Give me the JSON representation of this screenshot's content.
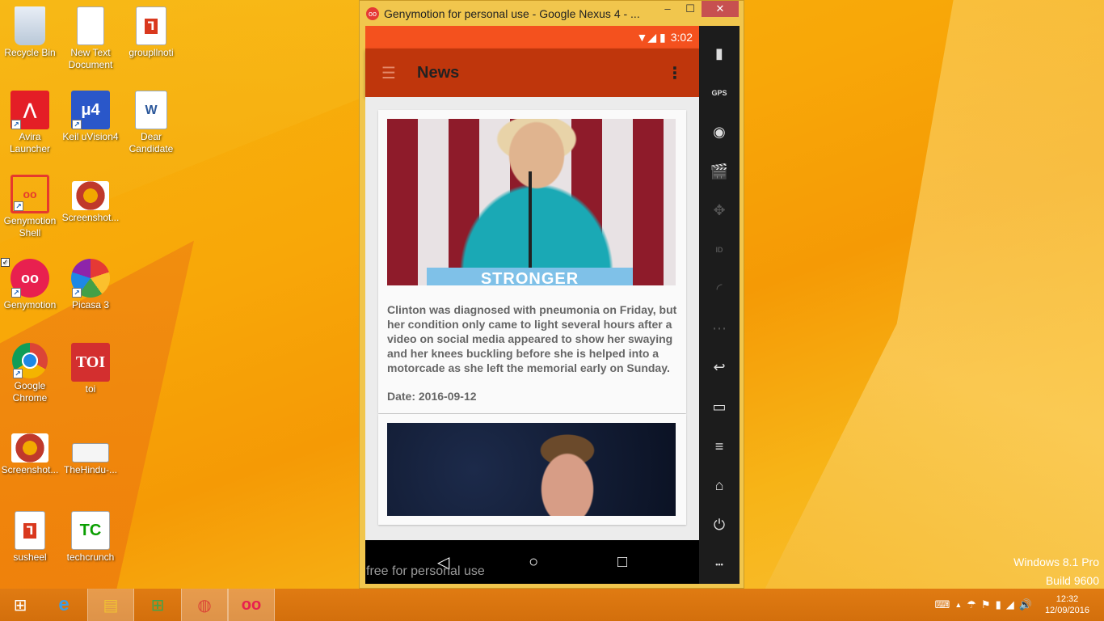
{
  "desktop": {
    "icons": [
      {
        "label": "Recycle Bin",
        "icon": "recycle-bin-icon"
      },
      {
        "label": "New Text Document",
        "icon": "text-document-icon"
      },
      {
        "label": "groupllnoti",
        "icon": "pdf-icon"
      },
      {
        "label": "Avira Launcher",
        "icon": "avira-icon"
      },
      {
        "label": "Keil uVision4",
        "icon": "keil-icon"
      },
      {
        "label": "Dear Candidate",
        "icon": "word-document-icon"
      },
      {
        "label": "Genymotion Shell",
        "icon": "genymotion-shell-icon"
      },
      {
        "label": "Screenshot...",
        "icon": "image-icon"
      },
      {
        "label": "Genymotion",
        "icon": "genymotion-icon"
      },
      {
        "label": "Picasa 3",
        "icon": "picasa-icon"
      },
      {
        "label": "Google Chrome",
        "icon": "chrome-icon"
      },
      {
        "label": "toi",
        "icon": "toi-icon"
      },
      {
        "label": "Screenshot...",
        "icon": "image-icon"
      },
      {
        "label": "TheHindu-...",
        "icon": "thehindu-icon"
      },
      {
        "label": "susheel",
        "icon": "pdf-icon"
      },
      {
        "label": "techcrunch",
        "icon": "techcrunch-icon"
      }
    ],
    "toi_glyph": "TOI",
    "tc_glyph": "TC"
  },
  "window": {
    "title": "Genymotion for personal use - Google Nexus 4 - ...",
    "logo": "oo",
    "minimize": "‒",
    "maximize": "☐",
    "close": "✕"
  },
  "phone": {
    "status_time": "3:02",
    "status_icons": "▼◢ ▮",
    "app_title": "News",
    "menu_glyph": "☰",
    "more_glyph": "⋮",
    "articles": [
      {
        "image_text": "STRONGER",
        "summary": "Clinton was diagnosed with pneumonia on Friday, but her condition only came to light several hours after a video on social media appeared to show her swaying and her knees buckling before she is helped into a motorcade as she left the memorial early on Sunday.",
        "date": "Date: 2016-09-12"
      }
    ],
    "nav": {
      "back": "◁",
      "home": "○",
      "recents": "□"
    },
    "watermark": "free for personal use"
  },
  "sidebar": [
    {
      "icon": "battery-icon",
      "glyph": "▮"
    },
    {
      "icon": "gps-icon",
      "glyph": "GPS"
    },
    {
      "icon": "camera-icon",
      "glyph": "◉"
    },
    {
      "icon": "media-icon",
      "glyph": "🎬"
    },
    {
      "icon": "dpad-icon",
      "glyph": "✥"
    },
    {
      "icon": "id-icon",
      "glyph": "ID"
    },
    {
      "icon": "cast-icon",
      "glyph": "◜"
    },
    {
      "icon": "sms-icon",
      "glyph": "⋯"
    },
    {
      "icon": "back-icon",
      "glyph": "↩"
    },
    {
      "icon": "recent-apps-icon",
      "glyph": "▭"
    },
    {
      "icon": "menu-icon",
      "glyph": "≡"
    },
    {
      "icon": "home-icon",
      "glyph": "⌂"
    },
    {
      "icon": "power-icon",
      "glyph": "⏻"
    },
    {
      "icon": "more-icon",
      "glyph": "•••"
    }
  ],
  "os": {
    "edition": "Windows 8.1 Pro",
    "build": "Build 9600"
  },
  "taskbar": {
    "start_glyph": "⊞",
    "apps": [
      {
        "icon": "internet-explorer-icon",
        "glyph": "e"
      },
      {
        "icon": "file-explorer-icon",
        "glyph": "▤"
      },
      {
        "icon": "store-icon",
        "glyph": "⊞"
      },
      {
        "icon": "chrome-icon",
        "glyph": "◍"
      },
      {
        "icon": "genymotion-icon",
        "glyph": "oo"
      }
    ],
    "tray": {
      "keyboard": "⌨",
      "chevron": "▲",
      "avira": "☂",
      "flag": "⚑",
      "network": "▮",
      "signal": "◢",
      "volume": "🔊"
    },
    "clock_time": "12:32",
    "clock_date": "12/09/2016"
  }
}
